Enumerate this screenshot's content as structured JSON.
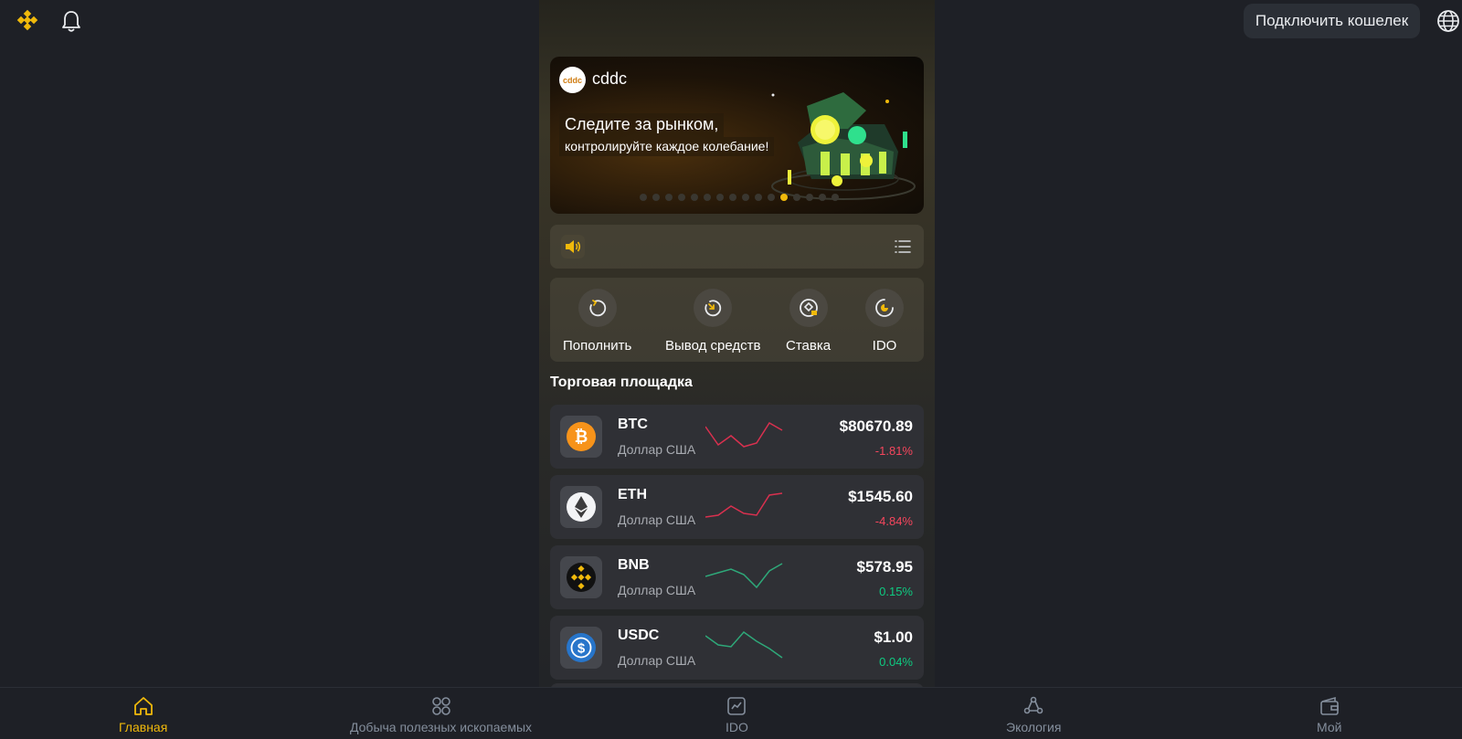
{
  "header": {
    "logo_icon": "binance-logo-icon",
    "bell_icon": "bell-icon",
    "connect_wallet_label": "Подключить кошелек",
    "language_icon": "globe-icon"
  },
  "banner": {
    "brand": "cddc",
    "brand_logo_text": "cddc",
    "title": "Следите за рынком,",
    "subtitle": "контролируйте каждое колебание!",
    "slide_count": 16,
    "active_slide": 11
  },
  "notice": {
    "speaker_icon": "speaker-icon",
    "list_icon": "list-icon"
  },
  "quick_actions": [
    {
      "label": "Пополнить",
      "icon": "deposit-icon"
    },
    {
      "label": "Вывод средств",
      "icon": "withdraw-icon"
    },
    {
      "label": "Ставка",
      "icon": "staking-icon"
    },
    {
      "label": "IDO",
      "icon": "ido-icon"
    }
  ],
  "market": {
    "title": "Торговая площадка",
    "coins": [
      {
        "symbol": "BTC",
        "quote": "Доллар США",
        "price": "$80670.89",
        "change": "-1.81%",
        "trend": "down",
        "icon": "bitcoin-icon",
        "color": "#f7931a"
      },
      {
        "symbol": "ETH",
        "quote": "Доллар США",
        "price": "$1545.60",
        "change": "-4.84%",
        "trend": "down",
        "icon": "ethereum-icon",
        "color": "#f3f4f6"
      },
      {
        "symbol": "BNB",
        "quote": "Доллар США",
        "price": "$578.95",
        "change": "0.15%",
        "trend": "up",
        "icon": "bnb-icon",
        "color": "#f0b90b"
      },
      {
        "symbol": "USDC",
        "quote": "Доллар США",
        "price": "$1.00",
        "change": "0.04%",
        "trend": "up",
        "icon": "usdc-icon",
        "color": "#2775ca"
      }
    ]
  },
  "bottom_nav": [
    {
      "label": "Главная",
      "icon": "home-icon",
      "active": true
    },
    {
      "label": "Добыча полезных ископаемых",
      "icon": "mining-icon",
      "active": false
    },
    {
      "label": "IDO",
      "icon": "ido-chart-icon",
      "active": false
    },
    {
      "label": "Экология",
      "icon": "ecology-icon",
      "active": false
    },
    {
      "label": "Мой",
      "icon": "wallet-icon",
      "active": false
    }
  ],
  "colors": {
    "accent": "#f0b90b",
    "negative": "#f6465d",
    "positive": "#0ecb81",
    "background": "#1e2026"
  }
}
